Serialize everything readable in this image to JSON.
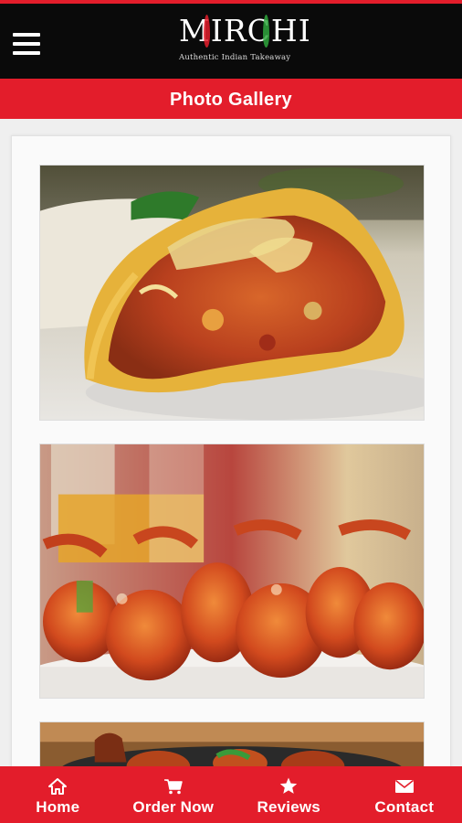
{
  "header": {
    "logo_text": "MIRCHI",
    "logo_tagline": "Authentic Indian Takeaway"
  },
  "page": {
    "title": "Photo Gallery"
  },
  "gallery": {
    "photos": [
      {
        "subject": "wrap"
      },
      {
        "subject": "prawn-skewers"
      },
      {
        "subject": "sizzler"
      }
    ]
  },
  "bottom_nav": {
    "items": [
      {
        "label": "Home",
        "icon": "home-icon"
      },
      {
        "label": "Order Now",
        "icon": "cart-icon"
      },
      {
        "label": "Reviews",
        "icon": "star-icon"
      },
      {
        "label": "Contact",
        "icon": "envelope-icon"
      }
    ]
  },
  "colors": {
    "accent": "#e31d2b",
    "header_bg": "#0a0a0a"
  }
}
